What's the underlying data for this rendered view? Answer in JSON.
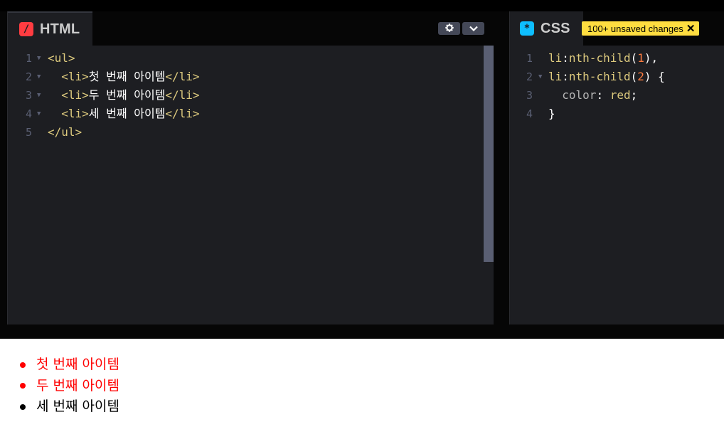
{
  "html_panel": {
    "title": "HTML",
    "icon": "html-slash-icon",
    "icon_glyph": "/",
    "icon_color": "#ff3c41",
    "settings_icon": "gear-icon",
    "collapse_icon": "chevron-down-icon",
    "code_lines": [
      {
        "n": "1",
        "tokens": [
          {
            "c": "tag",
            "t": "<ul>"
          }
        ]
      },
      {
        "n": "2",
        "tokens": [
          {
            "c": "text",
            "t": "  "
          },
          {
            "c": "tag",
            "t": "<li>"
          },
          {
            "c": "text",
            "t": "첫 번째 아이템"
          },
          {
            "c": "tag",
            "t": "</li>"
          }
        ]
      },
      {
        "n": "3",
        "tokens": [
          {
            "c": "text",
            "t": "  "
          },
          {
            "c": "tag",
            "t": "<li>"
          },
          {
            "c": "text",
            "t": "두 번째 아이템"
          },
          {
            "c": "tag",
            "t": "</li>"
          }
        ]
      },
      {
        "n": "4",
        "tokens": [
          {
            "c": "text",
            "t": "  "
          },
          {
            "c": "tag",
            "t": "<li>"
          },
          {
            "c": "text",
            "t": "세 번째 아이템"
          },
          {
            "c": "tag",
            "t": "</li>"
          }
        ]
      },
      {
        "n": "5",
        "tokens": [
          {
            "c": "tag",
            "t": "</ul>"
          }
        ]
      }
    ]
  },
  "css_panel": {
    "title": "CSS",
    "icon": "css-asterisk-icon",
    "icon_glyph": "*",
    "icon_color": "#0ebeff",
    "badge": "100+ unsaved changes",
    "badge_close": "✕",
    "code_lines": [
      {
        "n": "1",
        "tokens": [
          {
            "c": "tag",
            "t": "li"
          },
          {
            "c": "punc",
            "t": ":"
          },
          {
            "c": "tag",
            "t": "nth-child"
          },
          {
            "c": "punc",
            "t": "("
          },
          {
            "c": "num",
            "t": "1"
          },
          {
            "c": "punc",
            "t": "),"
          }
        ]
      },
      {
        "n": "2",
        "tokens": [
          {
            "c": "tag",
            "t": "li"
          },
          {
            "c": "punc",
            "t": ":"
          },
          {
            "c": "tag",
            "t": "nth-child"
          },
          {
            "c": "punc",
            "t": "("
          },
          {
            "c": "num",
            "t": "2"
          },
          {
            "c": "punc",
            "t": ") {"
          }
        ]
      },
      {
        "n": "3",
        "tokens": [
          {
            "c": "text",
            "t": "  "
          },
          {
            "c": "prop",
            "t": "color"
          },
          {
            "c": "punc",
            "t": ": "
          },
          {
            "c": "val",
            "t": "red"
          },
          {
            "c": "punc",
            "t": ";"
          }
        ]
      },
      {
        "n": "4",
        "tokens": [
          {
            "c": "punc",
            "t": "}"
          }
        ]
      }
    ]
  },
  "preview": {
    "items": [
      {
        "label": "첫 번째 아이템",
        "color": "red"
      },
      {
        "label": "두 번째 아이템",
        "color": "red"
      },
      {
        "label": "세 번째 아이템",
        "color": "black"
      }
    ]
  },
  "colors": {
    "editor_bg": "#1d1e22",
    "badge_bg": "#ffdd40",
    "preview_red": "#ff0000"
  }
}
